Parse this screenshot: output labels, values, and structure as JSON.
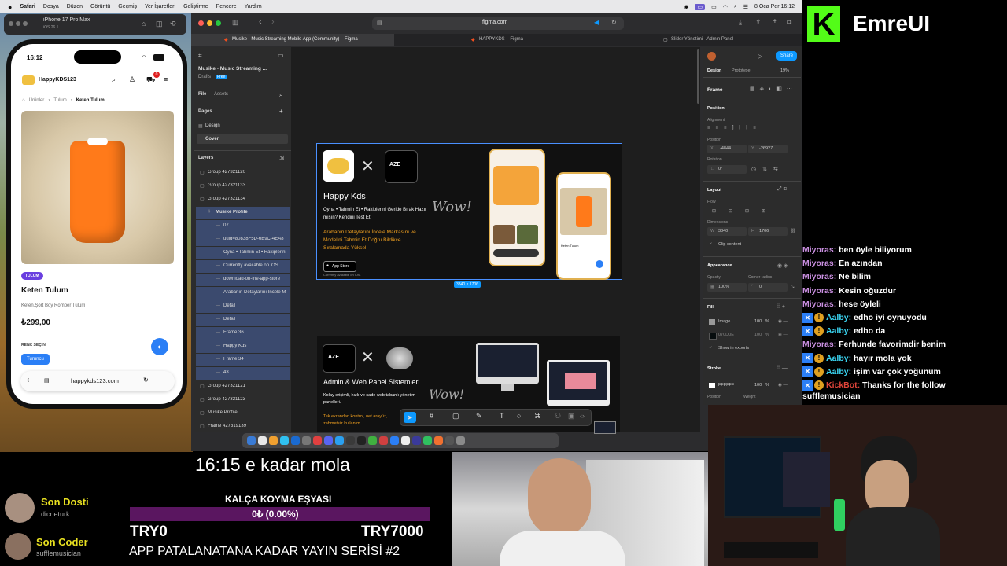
{
  "menubar": {
    "items": [
      "Safari",
      "Dosya",
      "Düzen",
      "Görüntü",
      "Geçmiş",
      "Yer İşaretleri",
      "Geliştirme",
      "Pencere",
      "Yardım"
    ],
    "datetime": "8 Oca Per 16:12"
  },
  "simulator": {
    "device": "iPhone 17 Pro Max",
    "os": "iOS 26.1"
  },
  "phone": {
    "time": "16:12",
    "brand": "HappyKDS123",
    "cart_badge": "0",
    "breadcrumb": [
      "Ürünler",
      "Tulum",
      "Keten Tulum"
    ],
    "category_badge": "TULUM",
    "product_title": "Keten Tulum",
    "product_desc": "Keten,Şort Boy Romper Tulum",
    "price": "₺299,00",
    "color_label": "RENK SEÇİN",
    "color_option": "Turuncu",
    "url": "happykds123.com"
  },
  "browser": {
    "url": "figma.com",
    "tabs": [
      "Musike - Music Streaming Mobile App (Community) – Figma",
      "HAPPYKDS – Figma",
      "Slider Yönetimi - Admin Panel"
    ]
  },
  "figma_left": {
    "file_name": "Musike - Music Streaming ...",
    "drafts": "Drafts",
    "free": "Free",
    "tab_file": "File",
    "tab_assets": "Assets",
    "pages_label": "Pages",
    "pages": [
      "Design",
      "Cover"
    ],
    "layers_label": "Layers",
    "layers": [
      {
        "name": "Group 427321120",
        "level": 0,
        "sel": false
      },
      {
        "name": "Group 427321133",
        "level": 0,
        "sel": false
      },
      {
        "name": "Group 427321134",
        "level": 0,
        "sel": false
      },
      {
        "name": "Musike Profile",
        "level": 1,
        "sel": true
      },
      {
        "name": "07",
        "level": 2,
        "sel": true
      },
      {
        "name": "uuid=80838F5D-6B9C-4EA8",
        "level": 2,
        "sel": true
      },
      {
        "name": "Oyna • Tahmin Et • Rakiplerini",
        "level": 2,
        "sel": true
      },
      {
        "name": "Currently available on iOS.",
        "level": 2,
        "sel": true
      },
      {
        "name": "download-on-the-app-store",
        "level": 2,
        "sel": true
      },
      {
        "name": "Arabanın Detaylarını İncele M",
        "level": 2,
        "sel": true
      },
      {
        "name": "Detail",
        "level": 2,
        "sel": true
      },
      {
        "name": "Detail",
        "level": 2,
        "sel": true
      },
      {
        "name": "Frame 36",
        "level": 2,
        "sel": true
      },
      {
        "name": "Happy Kds",
        "level": 2,
        "sel": true
      },
      {
        "name": "Frame 34",
        "level": 2,
        "sel": true
      },
      {
        "name": "43",
        "level": 2,
        "sel": true
      },
      {
        "name": "Group 427321121",
        "level": 0,
        "sel": false
      },
      {
        "name": "Group 427321123",
        "level": 0,
        "sel": false
      },
      {
        "name": "Musike Profile",
        "level": 0,
        "sel": false
      },
      {
        "name": "Frame 427319139",
        "level": 0,
        "sel": false
      }
    ]
  },
  "figma_right": {
    "share": "Share",
    "tab_design": "Design",
    "tab_prototype": "Prototype",
    "zoom": "19%",
    "frame_label": "Frame",
    "position_label": "Position",
    "alignment_label": "Alignment",
    "position_sub": "Position",
    "x": "-4844",
    "y": "-26927",
    "rotation_label": "Rotation",
    "rotation": "0°",
    "layout_label": "Layout",
    "flow_label": "Flow",
    "dimensions_label": "Dimensions",
    "w": "3840",
    "h": "1706",
    "clip": "Clip content",
    "appearance_label": "Appearance",
    "opacity_label": "Opacity",
    "radius_label": "Corner radius",
    "opacity": "100%",
    "radius": "0",
    "fill_label": "Fill",
    "fill1": "Image",
    "fill1_pct": "100",
    "fill2": "070D0E",
    "fill2_pct": "100",
    "show_exports": "Show in exports",
    "stroke_label": "Stroke",
    "stroke_hex": "FFFFFF",
    "stroke_pct": "100",
    "stroke_position": "Position",
    "stroke_weight": "Weight"
  },
  "canvas": {
    "frame1": {
      "title": "Happy Kds",
      "tagline": "Oyna • Tahmin Et • Rakiplerini Geride Bırak Hazır mısın? Kendini Test Et!",
      "promo": "Arabanın Detaylarını İncele Markasını ve Modelini Tahmin Et Doğru Bildikçe Sıralamada Yüksel",
      "appstore": "App Store",
      "available": "Currently available on iOS.",
      "size_label": "3840 × 1706",
      "aze": "AZE",
      "product": "Keten Tulum"
    },
    "frame2": {
      "title": "Admin & Web Panel Sistemleri",
      "desc": "Kolay erişimli, hızlı ve sade web tabanlı yönetim panelleri.",
      "promo": "Tek ekrandan kontrol, net arayüz, zahmetsiz kullanım.",
      "aze": "AZE"
    }
  },
  "brand": {
    "logo_letter": "K",
    "name": "EmreUI"
  },
  "chat": [
    {
      "user": "Miyoras",
      "msg": "ben öyle biliyorum",
      "color": "#c98fe0",
      "badges": false
    },
    {
      "user": "Miyoras",
      "msg": "En azından",
      "color": "#c98fe0",
      "badges": false
    },
    {
      "user": "Miyoras",
      "msg": "Ne bilim",
      "color": "#c98fe0",
      "badges": false
    },
    {
      "user": "Miyoras",
      "msg": "Kesin oğuzdur",
      "color": "#c98fe0",
      "badges": false
    },
    {
      "user": "Miyoras",
      "msg": "hese öyleli",
      "color": "#c98fe0",
      "badges": false
    },
    {
      "user": "Aalby",
      "msg": "edho iyi oynuyodu",
      "color": "#3ad3f0",
      "badges": true
    },
    {
      "user": "Aalby",
      "msg": "edho da",
      "color": "#3ad3f0",
      "badges": true
    },
    {
      "user": "Miyoras",
      "msg": "Ferhunde favorimdir benim",
      "color": "#c98fe0",
      "badges": false
    },
    {
      "user": "Aalby",
      "msg": "hayır mola yok",
      "color": "#3ad3f0",
      "badges": true
    },
    {
      "user": "Aalby",
      "msg": "işim var çok yoğunum",
      "color": "#3ad3f0",
      "badges": true
    },
    {
      "user": "KickBot",
      "msg": "Thanks for the follow",
      "color": "#e0453a",
      "badges": true
    }
  ],
  "chat_follow_user": "sufflemusician",
  "overlay": {
    "break_text": "16:15 e kadar mola",
    "goal_title": "KALÇA KOYMA EŞYASI",
    "goal_progress_text": "0₺ (0.00%)",
    "goal_progress": 0,
    "goal_min": "TRY0",
    "goal_max": "TRY7000",
    "series": "APP PATALANATANA KADAR YAYIN SERİSİ #2",
    "last_donor_label": "Son Dosti",
    "last_donor": "dicneturk",
    "last_coder_label": "Son Coder",
    "last_coder": "sufflemusician"
  },
  "colors": {
    "accent": "#53fc18",
    "figma_blue": "#0d99ff",
    "phone_accent": "#2b7ff6",
    "product_orange": "#ff7a1a",
    "purple_badge": "#6a3fe0",
    "goal_bar": "#5a1660"
  }
}
